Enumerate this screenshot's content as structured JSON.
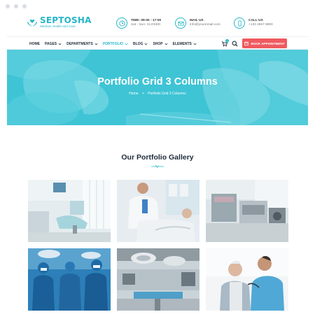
{
  "brand": {
    "name": "SEPTOSHA",
    "tagline": "Medical, Health and Care"
  },
  "info": {
    "time": {
      "title": "Time: 09:00 - 17:00",
      "sub": "Sat - Sun: CLOSED"
    },
    "mail": {
      "title": "Mail us",
      "sub": "info@youremail.com"
    },
    "call": {
      "title": "Call us",
      "sub": "+123 4567 8900"
    }
  },
  "nav": {
    "items": [
      "HOME",
      "PAGES",
      "DEPARTMENTS",
      "PORTFOLIO",
      "BLOG",
      "SHOP",
      "ELEMENTS"
    ],
    "active": "PORTFOLIO",
    "cart_count": "0",
    "book_label": "BOOK APPOINTMENT"
  },
  "hero": {
    "title": "Portfolio Grid 3 Columns",
    "crumb_home": "Home",
    "crumb_sep": ">",
    "crumb_current": "Portfolio Grid 3 Columns"
  },
  "gallery": {
    "title": "Our Portfolio Gallery",
    "images": [
      "dental-clinic-chair",
      "doctor-with-patient-in-bed",
      "laboratory-equipment",
      "surgeons-team",
      "operating-room",
      "doctor-checking-elderly-patient"
    ]
  },
  "colors": {
    "accent": "#25b6c8",
    "hero": "#3fc6d6",
    "button": "#ef5a5f",
    "nav_text": "#1d2a3a"
  }
}
